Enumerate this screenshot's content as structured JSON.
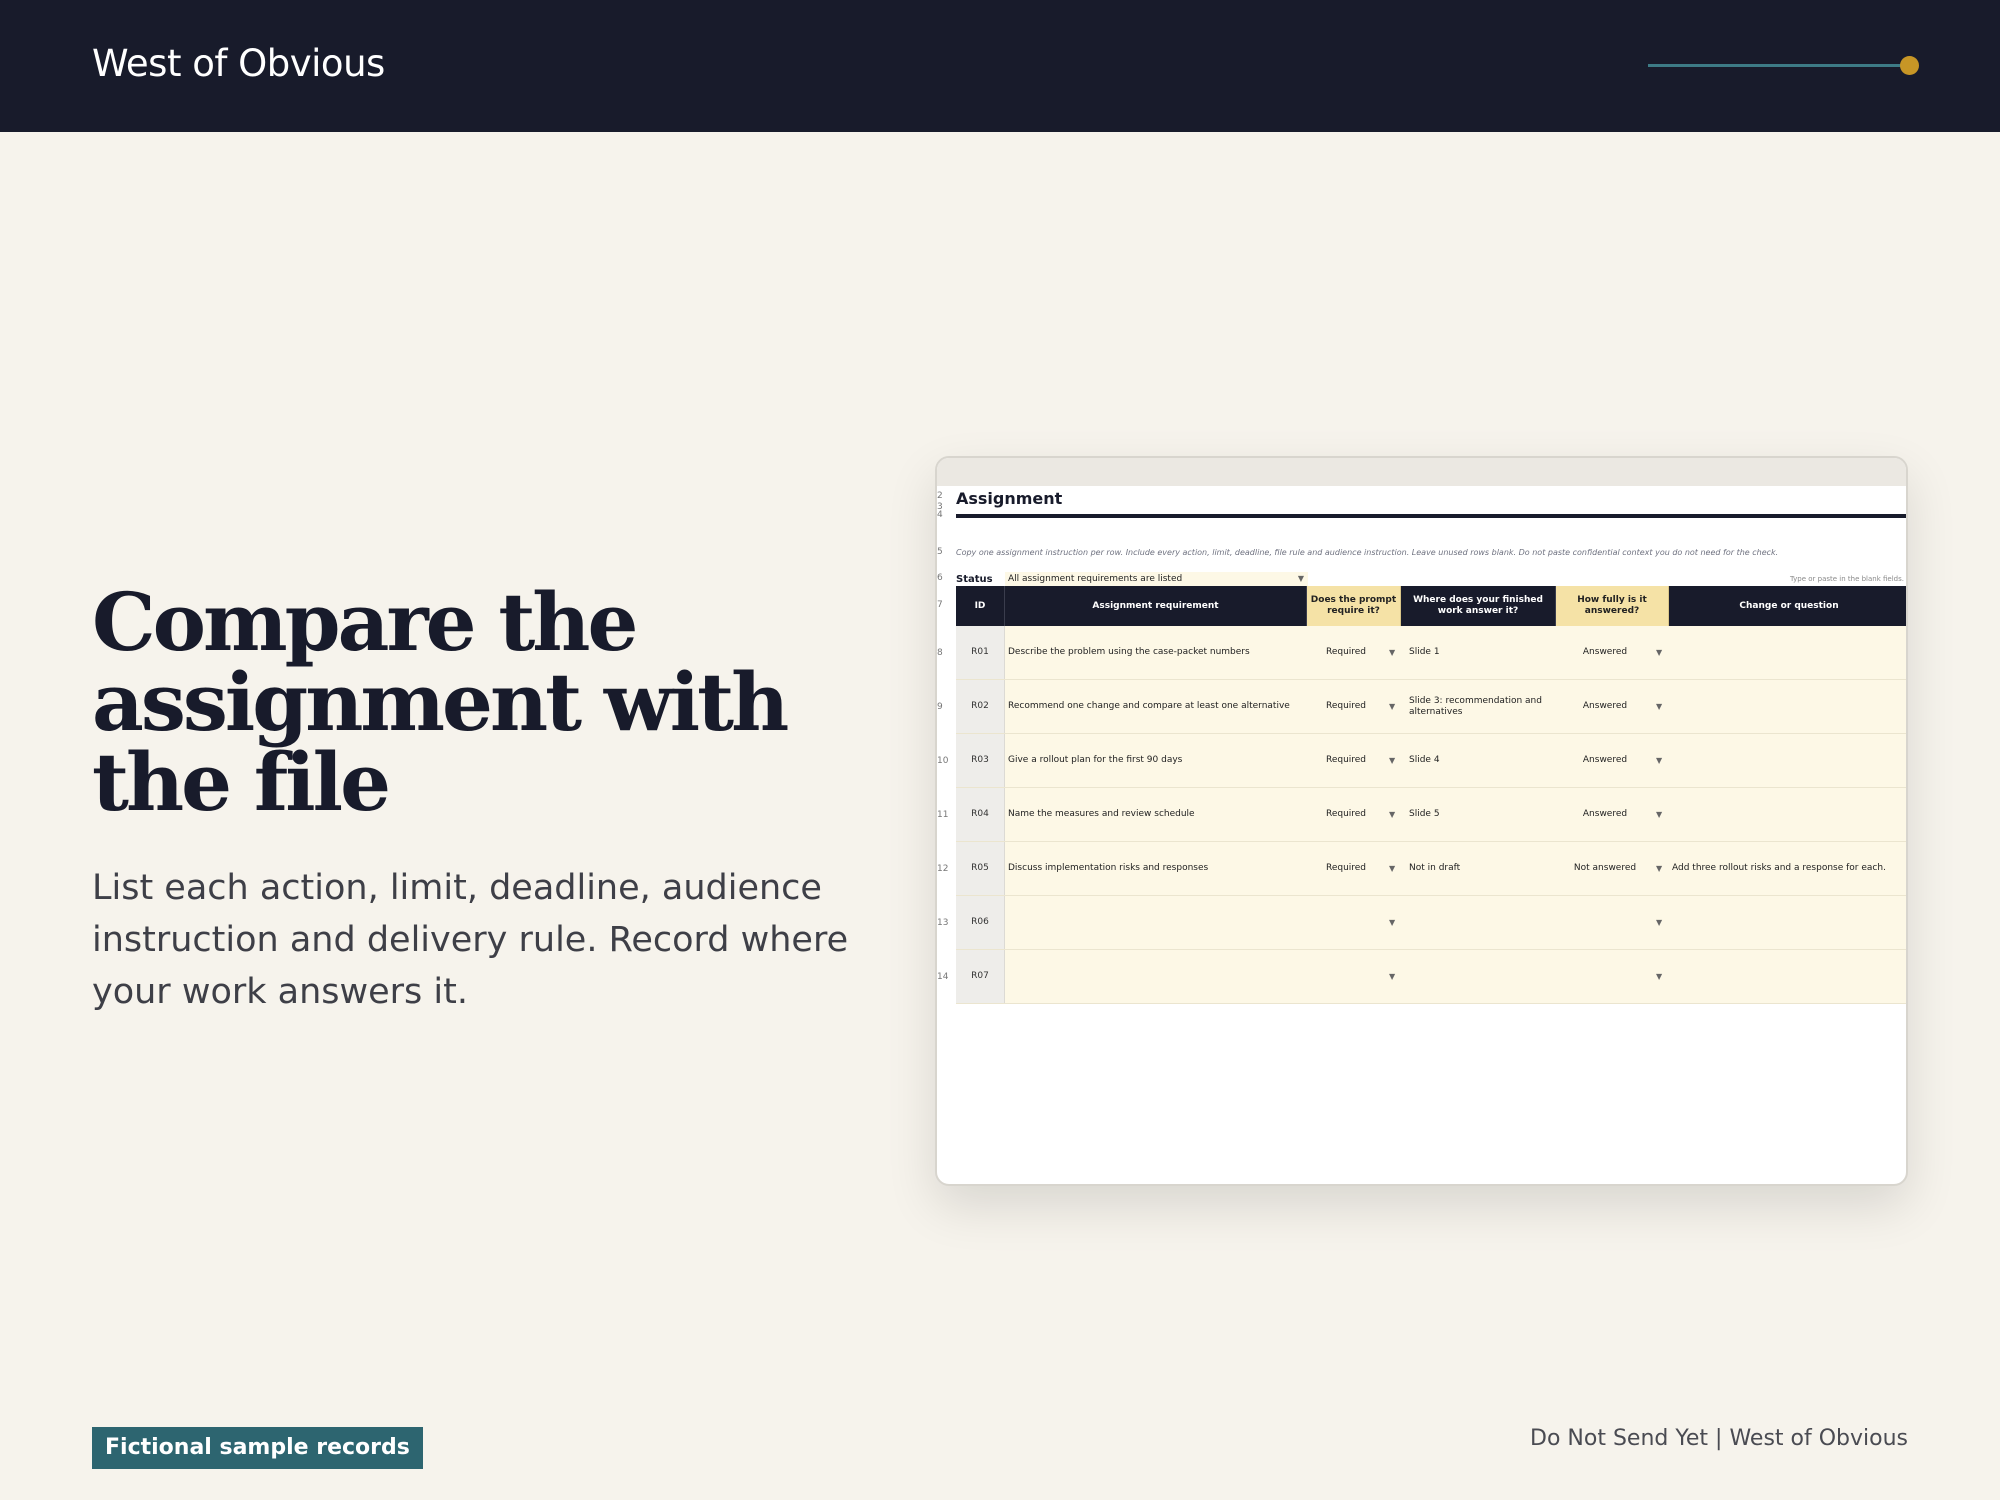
{
  "header": {
    "brand": "West of Obvious",
    "progress_fraction": 1.0,
    "accent_color": "#c79626"
  },
  "hero": {
    "headline": "Compare the assignment with the file",
    "body": "List each action, limit, deadline, audience instruction and delivery rule. Record where your work answers it."
  },
  "footer": {
    "tag": "Fictional sample records",
    "right": "Do Not Send Yet | West of Obvious"
  },
  "sheet": {
    "title": "Assignment",
    "row_numbers": {
      "title": "2",
      "r3": "3",
      "r4": "4",
      "instruction": "5",
      "status": "6",
      "header": "7"
    },
    "instruction": "Copy one assignment instruction per row. Include every action, limit, deadline, file rule and audience instruction. Leave unused rows blank. Do not paste confidential context you do not need for the check.",
    "status_label": "Status",
    "status_value": "All assignment requirements are listed",
    "hint": "Type or paste in the blank fields.",
    "columns": {
      "id": "ID",
      "requirement": "Assignment requirement",
      "prompt": "Does the prompt require it?",
      "where": "Where does your finished work answer it?",
      "how": "How fully is it answered?",
      "change": "Change or question"
    },
    "rows": [
      {
        "num": "8",
        "id": "R01",
        "requirement": "Describe the problem using the case-packet numbers",
        "prompt": "Required",
        "where": "Slide 1",
        "how": "Answered",
        "change": ""
      },
      {
        "num": "9",
        "id": "R02",
        "requirement": "Recommend one change and compare at least one alternative",
        "prompt": "Required",
        "where": "Slide 3: recommendation and alternatives",
        "how": "Answered",
        "change": ""
      },
      {
        "num": "10",
        "id": "R03",
        "requirement": "Give a rollout plan for the first 90 days",
        "prompt": "Required",
        "where": "Slide 4",
        "how": "Answered",
        "change": ""
      },
      {
        "num": "11",
        "id": "R04",
        "requirement": "Name the measures and review schedule",
        "prompt": "Required",
        "where": "Slide 5",
        "how": "Answered",
        "change": ""
      },
      {
        "num": "12",
        "id": "R05",
        "requirement": "Discuss implementation risks and responses",
        "prompt": "Required",
        "where": "Not in draft",
        "how": "Not answered",
        "change": "Add three rollout risks and a response for each."
      },
      {
        "num": "13",
        "id": "R06",
        "requirement": "",
        "prompt": "",
        "where": "",
        "how": "",
        "change": ""
      },
      {
        "num": "14",
        "id": "R07",
        "requirement": "",
        "prompt": "",
        "where": "",
        "how": "",
        "change": ""
      }
    ]
  }
}
